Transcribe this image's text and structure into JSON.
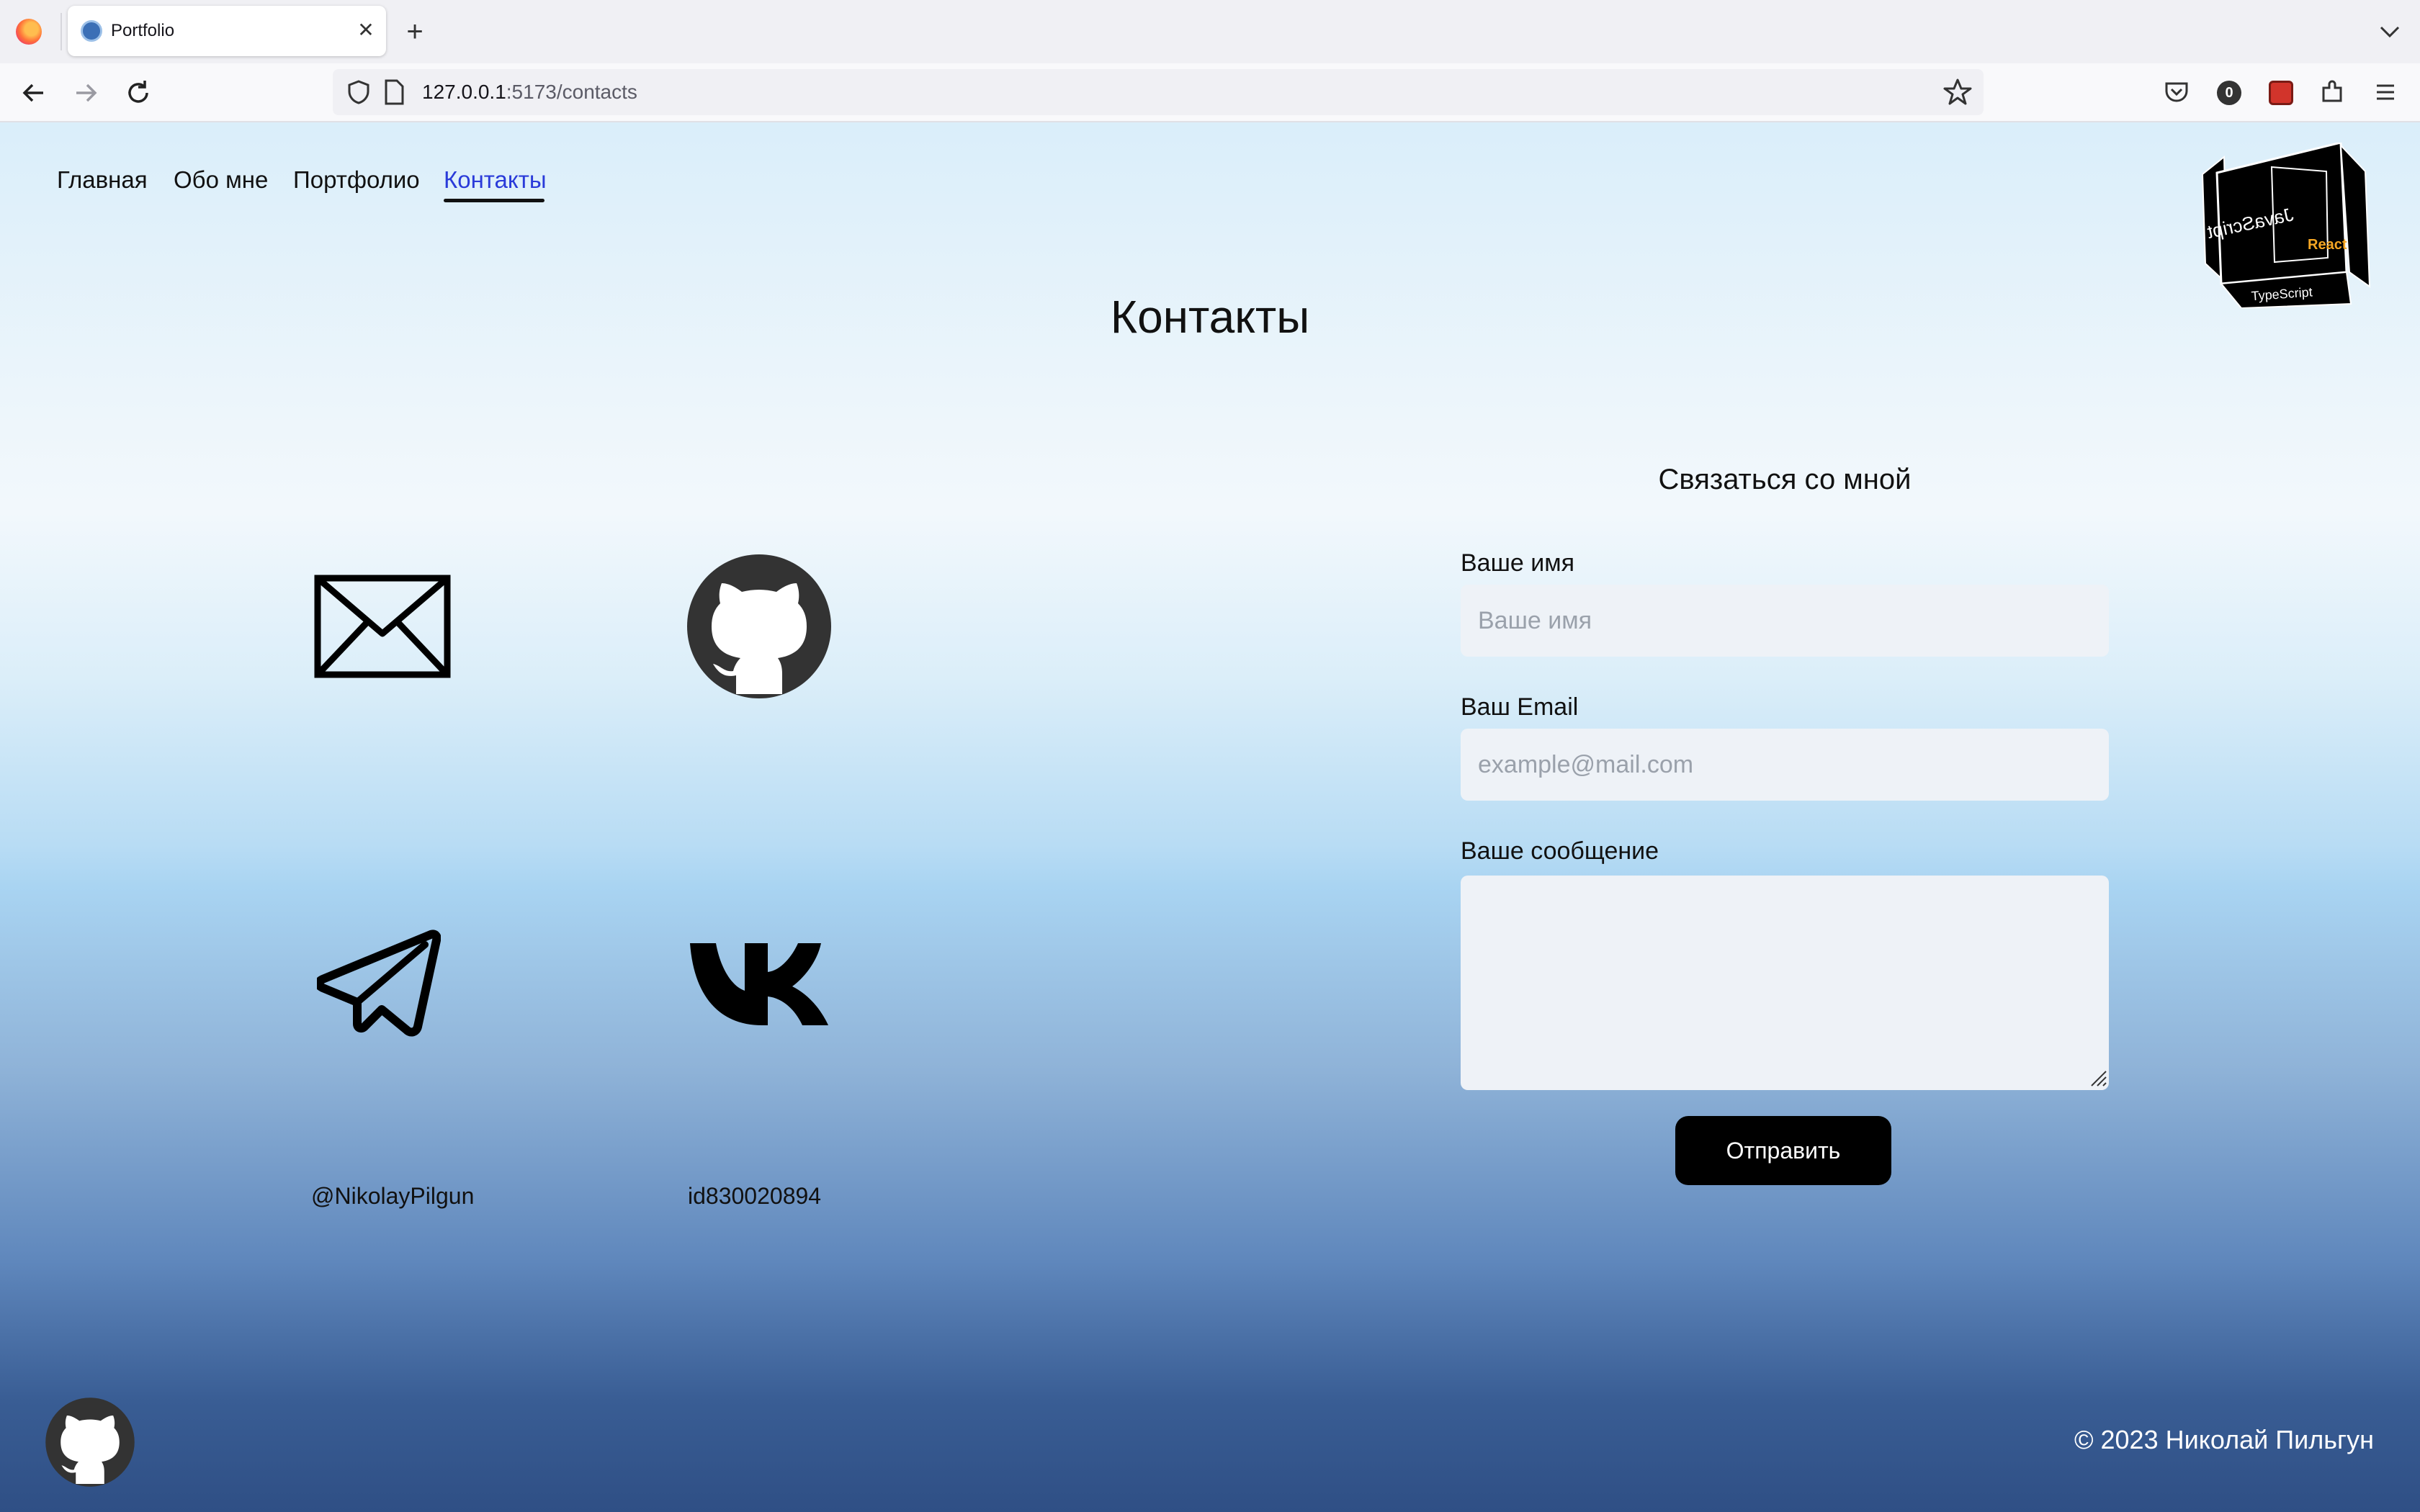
{
  "browser": {
    "tab_title": "Portfolio",
    "url_host": "127.0.0.1",
    "url_path": ":5173/contacts",
    "extension_badge": "0"
  },
  "nav": {
    "items": [
      {
        "label": "Главная"
      },
      {
        "label": "Обо мне"
      },
      {
        "label": "Портфолио"
      },
      {
        "label": "Контакты",
        "active": true
      }
    ]
  },
  "cube": {
    "front_text": "JavaScript",
    "bottom_text": "TypeScript",
    "side_text": "React"
  },
  "page": {
    "title": "Контакты"
  },
  "contacts": [
    {
      "icon": "mail-icon",
      "label": ""
    },
    {
      "icon": "github-icon",
      "label": ""
    },
    {
      "icon": "telegram-icon",
      "label": "@NikolayPilgun"
    },
    {
      "icon": "vk-icon",
      "label": "id830020894"
    }
  ],
  "form": {
    "heading": "Связаться со мной",
    "name_label": "Ваше имя",
    "name_placeholder": "Ваше имя",
    "email_label": "Ваш Email",
    "email_placeholder": "example@mail.com",
    "message_label": "Ваше сообщение",
    "submit_label": "Отправить"
  },
  "footer": {
    "copyright": "© 2023 Николай Пильгун"
  },
  "colors": {
    "active_link": "#2a3bd9",
    "button_bg": "#000000",
    "input_bg": "#eef2f7"
  }
}
